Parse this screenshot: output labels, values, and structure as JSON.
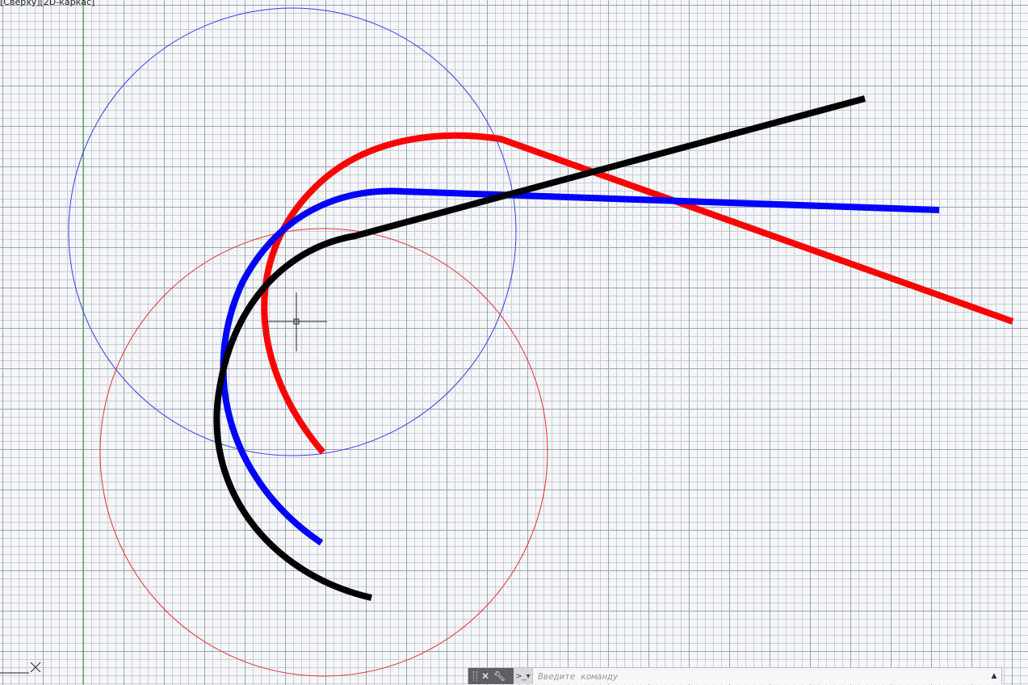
{
  "viewport": {
    "label": "[Сверху][2D-каркас]"
  },
  "colors": {
    "grid_major": "#9aa3b3",
    "grid_minor": "#c7ccd6",
    "background": "#f4f6f8",
    "guide_circle_blue": "#3a3af0",
    "guide_circle_red": "#e83030",
    "polyline_red": "#ff0000",
    "polyline_blue": "#0000ff",
    "polyline_black": "#000000",
    "y_axis_line": "#3c9a3c"
  },
  "command_line": {
    "placeholder": "Введите команду",
    "close_icon": "close-icon",
    "settings_icon": "wrench-icon",
    "prompt_icon": "command-prompt-icon",
    "history_icon": "chevron-up-icon"
  }
}
